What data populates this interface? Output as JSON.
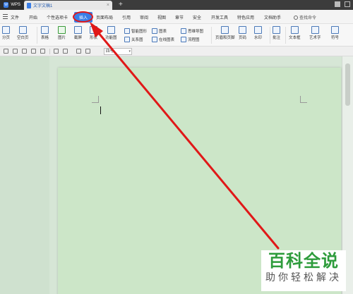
{
  "titlebar": {
    "app_label": "WPS",
    "doc_tab": "文字文稿1",
    "close_glyph": "×",
    "new_tab_glyph": "+"
  },
  "menu": {
    "file": "文件",
    "items": [
      "开始",
      "个性选项卡",
      "插入",
      "页面布局",
      "引用",
      "审阅",
      "视图",
      "章节",
      "安全",
      "开发工具",
      "特色应用",
      "文档助手"
    ],
    "active_index": 2,
    "search": "查找命令"
  },
  "ribbon": {
    "page_break": "分页",
    "blank_page": "空白页",
    "table": "表格",
    "picture": "图片",
    "screenshot": "截屏",
    "shape": "形状",
    "function_chart": "功能图",
    "smart_shape": "智能图形",
    "chart": "图表",
    "mind_map": "思维导图",
    "relationship": "关系图",
    "online_chart": "在线图表",
    "flowchart": "流程图",
    "header_footer": "页眉和页脚",
    "page_number": "页码",
    "watermark": "水印",
    "comment": "批注",
    "textbox": "文本框",
    "art_text": "艺术字",
    "symbol": "符号"
  },
  "quickbar": {
    "style": "四号"
  },
  "watermark": {
    "main": "百科全说",
    "sub": "助你轻松解决"
  },
  "colors": {
    "accent": "#3a7ee6",
    "annotation": "#e01818",
    "page": "#cce6c8",
    "brand_green": "#2e9c3c"
  }
}
